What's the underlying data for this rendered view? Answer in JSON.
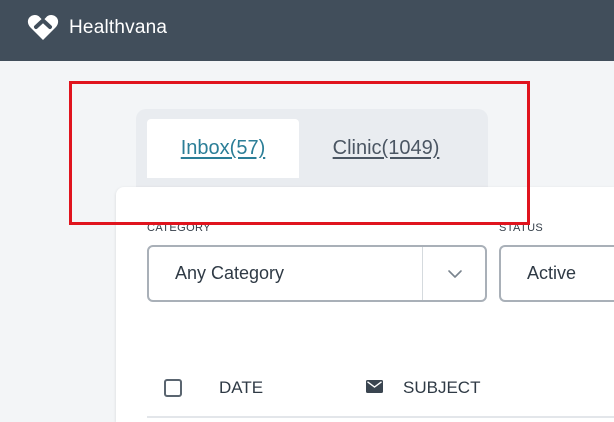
{
  "header": {
    "brand": "Healthvana",
    "logo_icon": "heart-icon",
    "background_color": "#414e5b"
  },
  "tabs": [
    {
      "label": "Inbox(57)",
      "active": true
    },
    {
      "label": "Clinic(1049)",
      "active": false
    }
  ],
  "filters": {
    "category": {
      "label": "CATEGORY",
      "value": "Any Category",
      "icon": "chevron-down-icon"
    },
    "status": {
      "label": "STATUS",
      "value": "Active"
    }
  },
  "table": {
    "columns": [
      {
        "label": "DATE"
      },
      {
        "label": "SUBJECT",
        "icon": "envelope-icon"
      }
    ]
  },
  "annotation": {
    "color": "#e0141e"
  },
  "colors": {
    "accent": "#2b7e97",
    "tab_bar": "#e9ecf0",
    "page_background": "#f3f5f7"
  }
}
